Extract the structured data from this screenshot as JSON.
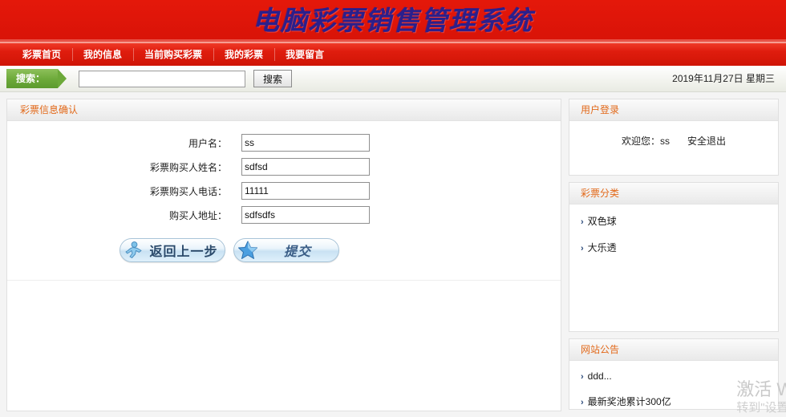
{
  "banner": {
    "title": "电脑彩票销售管理系统"
  },
  "nav": {
    "items": [
      {
        "label": "彩票首页"
      },
      {
        "label": "我的信息"
      },
      {
        "label": "当前购买彩票"
      },
      {
        "label": "我的彩票"
      },
      {
        "label": "我要留言"
      }
    ]
  },
  "search": {
    "label": "搜索：",
    "value": "",
    "placeholder": "",
    "button_label": "搜索",
    "date": "2019年11月27日 星期三"
  },
  "main": {
    "panel_title": "彩票信息确认",
    "fields": [
      {
        "label": "用户名：",
        "value": "ss"
      },
      {
        "label": "彩票购买人姓名：",
        "value": "sdfsd"
      },
      {
        "label": "彩票购买人电话：",
        "value": "11111"
      },
      {
        "label": "购买人地址：",
        "value": "sdfsdfs"
      }
    ],
    "back_button": "返回上一步",
    "submit_button": "提交"
  },
  "sidebar": {
    "login_panel": {
      "title": "用户登录",
      "welcome_prefix": "欢迎您：",
      "username": "ss",
      "logout_label": "安全退出"
    },
    "category_panel": {
      "title": "彩票分类",
      "items": [
        {
          "label": "双色球"
        },
        {
          "label": "大乐透"
        }
      ]
    },
    "notice_panel": {
      "title": "网站公告",
      "items": [
        {
          "label": "ddd..."
        },
        {
          "label": "最新奖池累计300亿"
        }
      ]
    }
  },
  "watermark": {
    "line1": "激活 Wi",
    "line2": "转到\"设置"
  },
  "colors": {
    "banner_red": "#e01609",
    "nav_red": "#e2190c",
    "title_blue": "#2b1f8c",
    "panel_title_orange": "#e2691a",
    "search_green": "#6ca939"
  }
}
